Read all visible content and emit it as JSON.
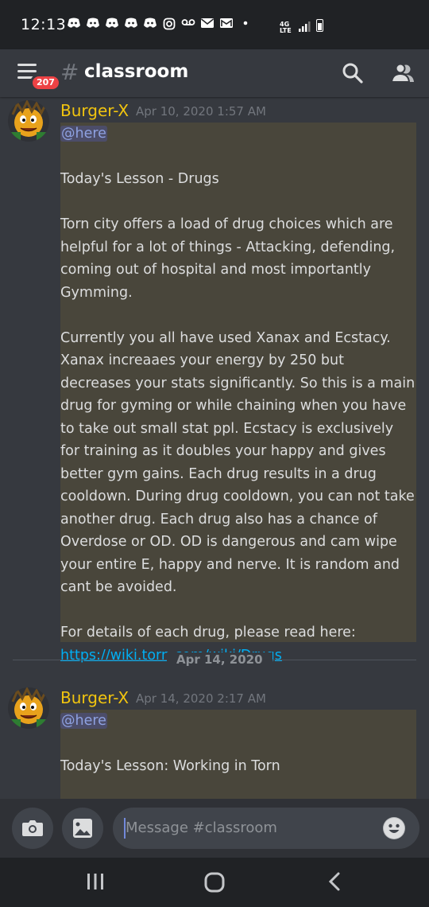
{
  "status_bar": {
    "time": "12:13",
    "network": "4G LTE"
  },
  "header": {
    "badge_count": "207",
    "hash_symbol": "#",
    "channel_name": "classroom"
  },
  "messages": [
    {
      "author": "Burger-X",
      "timestamp": "Apr 10, 2020 1:57 AM",
      "mention": "@here",
      "lines": [
        "Today's Lesson - Drugs",
        "Torn city offers a load of drug choices which are helpful for a lot of things - Attacking, defending, coming out of hospital and most importantly Gymming.",
        "Currently you all have used Xanax and Ecstacy. Xanax increaaes your energy by 250 but decreases your stats significantly. So this is a main drug for gyming or while chaining when you have to take out small stat ppl. Ecstacy is exclusively for training as it doubles your happy and gives better gym gains. Each drug results in a drug cooldown. During drug cooldown, you can not take another drug. Each drug also has a chance of Overdose or OD. OD is dangerous and cam wipe your entire E, happy and nerve.  It is random and cant be avoided.",
        "For details of each drug, please read here:"
      ],
      "link": "https://wiki.torn.com/wiki/Drugs"
    },
    {
      "author": "Burger-X",
      "timestamp": "Apr 14, 2020 2:17 AM",
      "mention": "@here",
      "lines": [
        "Today's Lesson: Working in Torn"
      ]
    }
  ],
  "date_divider": "Apr 14, 2020",
  "composer": {
    "placeholder": "Message #classroom"
  },
  "colors": {
    "background": "#36393f",
    "highlight": "#49463b",
    "author": "#f1c40f",
    "mention": "#8ea1e1",
    "link": "#00aff4",
    "badge": "#ed4245"
  },
  "icons": {
    "menu": "hamburger-icon",
    "search": "search-icon",
    "members": "members-icon",
    "camera": "camera-icon",
    "gallery": "image-icon",
    "emoji": "emoji-icon"
  }
}
